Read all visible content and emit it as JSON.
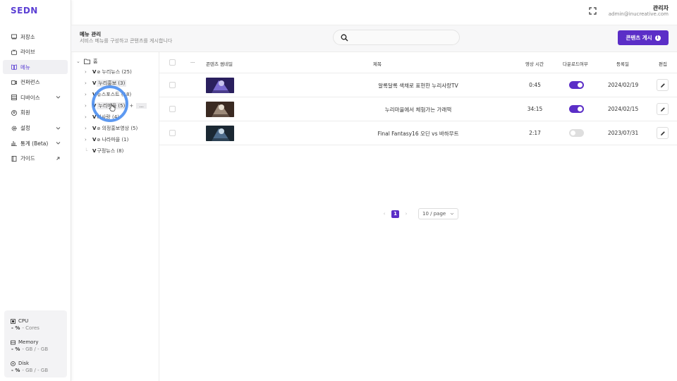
{
  "app": {
    "logo": "SEDN"
  },
  "sidebar": {
    "items": [
      {
        "label": "저장소",
        "icon": "storage-icon"
      },
      {
        "label": "라이브",
        "icon": "live-icon"
      },
      {
        "label": "메뉴",
        "icon": "menu-icon",
        "active": true
      },
      {
        "label": "컨퍼런스",
        "icon": "conference-icon"
      },
      {
        "label": "디바이스",
        "icon": "device-icon",
        "expandable": true
      },
      {
        "label": "회원",
        "icon": "member-icon"
      },
      {
        "label": "설정",
        "icon": "settings-icon",
        "expandable": true
      },
      {
        "label": "통계 (Beta)",
        "icon": "stats-icon",
        "expandable": true
      },
      {
        "label": "가이드",
        "icon": "guide-icon",
        "external": true
      }
    ],
    "resources": {
      "cpu": {
        "title": "CPU",
        "pct": "- %",
        "sub": "- Cores"
      },
      "memory": {
        "title": "Memory",
        "pct": "- %",
        "sub": "- GB / - GB"
      },
      "disk": {
        "title": "Disk",
        "pct": "- %",
        "sub": "- GB / - GB"
      }
    }
  },
  "topbar": {
    "user_name": "관리자",
    "user_email": "admin@inucreative.com"
  },
  "page_header": {
    "title": "메뉴 관리",
    "description": "서비스 메뉴를 구성하고 콘텐츠를 게시합니다",
    "search_placeholder": "",
    "post_button": "콘텐츠 게시"
  },
  "tree": {
    "root": "홈",
    "items": [
      {
        "label": "누리뉴스 (25)",
        "hidden_icon": true
      },
      {
        "label": "누리홍보 (3)"
      },
      {
        "label": "뉴스포스트 (18)"
      },
      {
        "label": "누리마을 (5)",
        "selected": true,
        "more": "..."
      },
      {
        "label": "리사랑 (4)"
      },
      {
        "label": "의정홍보영상 (5)",
        "hidden_icon": true
      },
      {
        "label": "나라마을 (1)",
        "hidden_icon": true
      },
      {
        "label": "구정뉴스 (8)"
      }
    ]
  },
  "table": {
    "headers": {
      "more": "...",
      "thumbnail": "콘텐츠 썸네일",
      "title": "제목",
      "duration": "영상 시간",
      "download": "다운로드여부",
      "date": "등록일",
      "edit": "편집"
    },
    "rows": [
      {
        "title": "알록달록 색채로 표현한 누리사랑TV",
        "duration": "0:45",
        "download": true,
        "date": "2024/02/19",
        "thumb_colors": [
          "#2a1f5e",
          "#7a6ad0",
          "#c9c4ef"
        ]
      },
      {
        "title": "누리마을에서 체험가는 가래떡",
        "duration": "34:15",
        "download": true,
        "date": "2024/02/15",
        "thumb_colors": [
          "#3a2a22",
          "#9c8a7a",
          "#e6ddd0"
        ]
      },
      {
        "title": "Final Fantasy16 오딘 vs 바하무트",
        "duration": "2:17",
        "download": false,
        "date": "2023/07/31",
        "thumb_colors": [
          "#1b2833",
          "#4d6b8a",
          "#c7d8e6"
        ]
      }
    ]
  },
  "pager": {
    "prev": "‹",
    "current": "1",
    "next": "›",
    "page_size": "10 / page"
  }
}
